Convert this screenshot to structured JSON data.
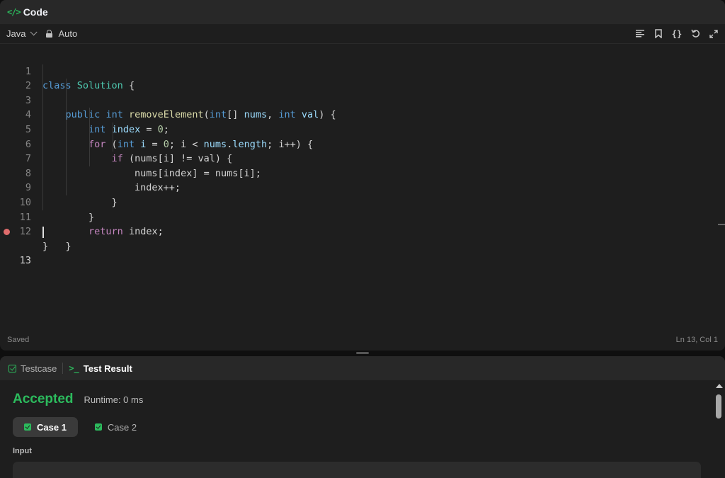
{
  "editor": {
    "title": "Code",
    "language": "Java",
    "mode": "Auto",
    "toolbar_icons": [
      "format-icon",
      "bookmark-icon",
      "braces-icon",
      "reset-icon",
      "expand-icon"
    ],
    "status_left": "Saved",
    "status_right": "Ln 13, Col 1",
    "code_lines": [
      "class Solution {",
      "    public int removeElement(int[] nums, int val) {",
      "        int index = 0;",
      "        for (int i = 0; i < nums.length; i++) {",
      "            if (nums[i] != val) {",
      "                nums[index] = nums[i];",
      "                index++;",
      "            }",
      "        }",
      "        return index;",
      "    }",
      "}",
      ""
    ],
    "line_numbers": [
      "1",
      "2",
      "3",
      "4",
      "5",
      "6",
      "7",
      "8",
      "9",
      "10",
      "11",
      "12",
      "13"
    ]
  },
  "result_panel": {
    "tabs": [
      {
        "label": "Testcase"
      },
      {
        "label": "Test Result"
      }
    ],
    "status": "Accepted",
    "runtime": "Runtime: 0 ms",
    "cases": [
      {
        "label": "Case 1"
      },
      {
        "label": "Case 2"
      }
    ],
    "input_label": "Input"
  },
  "colors": {
    "accent_green": "#2cbb5d",
    "breakpoint": "#e06c6c"
  }
}
